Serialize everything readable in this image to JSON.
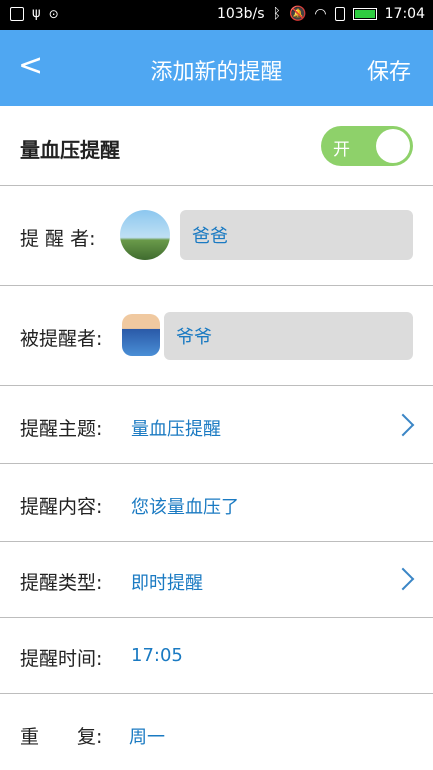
{
  "status_bar": {
    "speed": "103b/s",
    "time": "17:04"
  },
  "header": {
    "title": "添加新的提醒",
    "save_label": "保存"
  },
  "toggle_row": {
    "label": "量血压提醒",
    "toggle_text": "开"
  },
  "reminder_by": {
    "label": "提 醒 者:",
    "value": "爸爸"
  },
  "reminded": {
    "label": "被提醒者:",
    "value": "爷爷"
  },
  "subject": {
    "label": "提醒主题:",
    "value": "量血压提醒"
  },
  "content": {
    "label": "提醒内容:",
    "value": "您该量血压了"
  },
  "type": {
    "label": "提醒类型:",
    "value": "即时提醒"
  },
  "time": {
    "label": "提醒时间:",
    "value": "17:05"
  },
  "repeat": {
    "label": "重　　复:",
    "value": "周一"
  }
}
